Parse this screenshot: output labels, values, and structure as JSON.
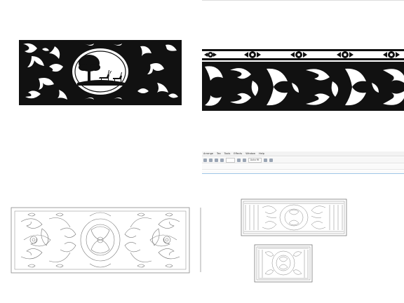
{
  "tiles": [
    {
      "name": "black-panel-with-deer-tree"
    },
    {
      "name": "black-scroll-border-strip"
    },
    {
      "name": "outline-scroll-panel"
    },
    {
      "name": "cad-editor-screenshot"
    }
  ],
  "editor": {
    "menu": [
      "Arrange",
      "Tex",
      "Tools",
      "Effects",
      "Window",
      "Help"
    ],
    "toolbar_zoom": "Auto fit"
  },
  "colors": {
    "ink": "#111111",
    "outline": "#777777",
    "ruler": "#9ec6e8"
  }
}
